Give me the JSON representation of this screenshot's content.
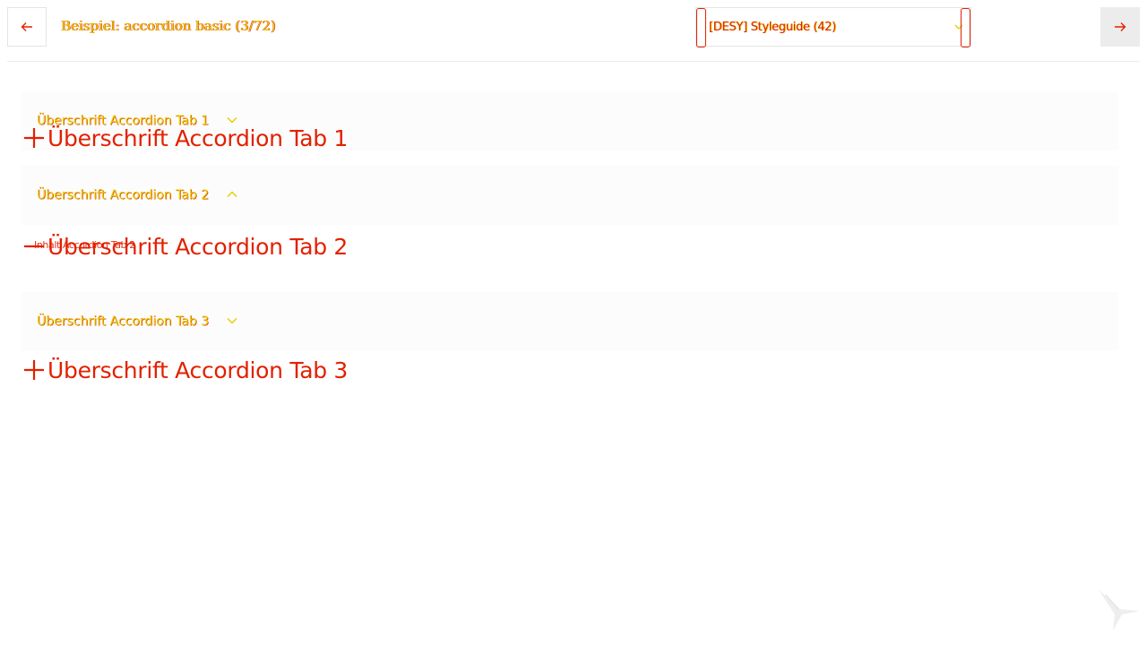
{
  "toolbar": {
    "prev_icon": "arrow-left-icon",
    "next_icon": "arrow-right-icon",
    "title": "Beispiel: accordion basic (3/72)",
    "select_value": "[DESY] Styleguide (42)",
    "select_icon": "chevron-down-icon"
  },
  "accordion": {
    "items": [
      {
        "label": "Überschrift Accordion Tab 1",
        "expanded": false,
        "sign_icon": "plus-icon",
        "chevron_icon": "chevron-down-icon"
      },
      {
        "label": "Überschrift Accordion Tab 2",
        "expanded": true,
        "sign_icon": "minus-icon",
        "chevron_icon": "chevron-up-icon",
        "content": "Inhalt Accordion Tab 2"
      },
      {
        "label": "Überschrift Accordion Tab 3",
        "expanded": false,
        "sign_icon": "plus-icon",
        "chevron_icon": "chevron-down-icon"
      }
    ]
  },
  "colors": {
    "accent_red": "#e32000",
    "accent_yellow": "#e6cf00",
    "panel_bg": "#fcfcfc",
    "border": "#e4e4e4"
  },
  "logo": "bird-logo"
}
